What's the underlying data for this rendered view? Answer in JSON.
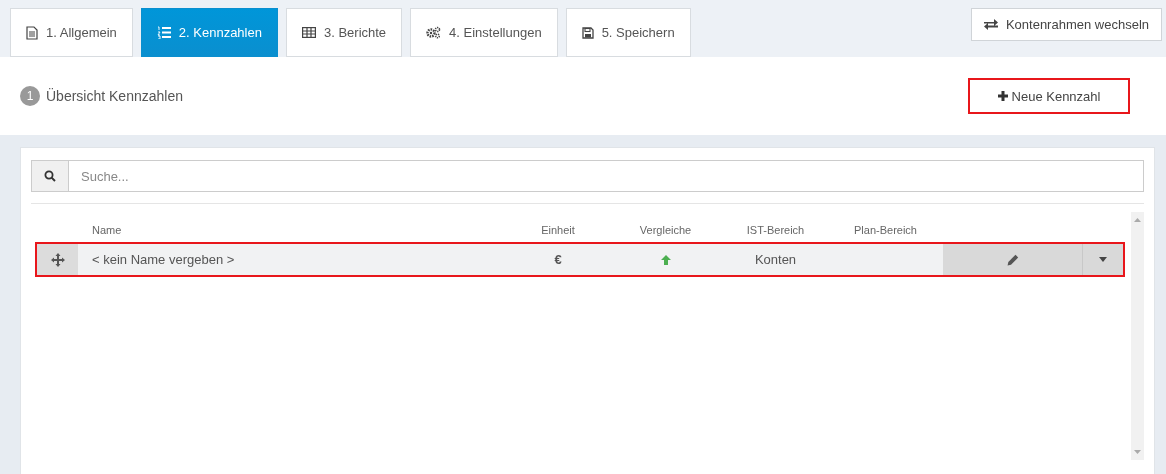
{
  "tabs": [
    {
      "label": "1. Allgemein",
      "selected": false
    },
    {
      "label": "2. Kennzahlen",
      "selected": true
    },
    {
      "label": "3. Berichte",
      "selected": false
    },
    {
      "label": "4. Einstellungen",
      "selected": false
    },
    {
      "label": "5. Speichern",
      "selected": false
    }
  ],
  "switch_button": {
    "label": "Kontenrahmen wechseln"
  },
  "section": {
    "step": "1",
    "title": "Übersicht Kennzahlen"
  },
  "new_button": {
    "label": "Neue Kennzahl",
    "highlighted": true
  },
  "search": {
    "placeholder": "Suche..."
  },
  "table": {
    "columns": [
      "Name",
      "Einheit",
      "Vergleiche",
      "IST-Bereich",
      "Plan-Bereich"
    ],
    "rows": [
      {
        "name": "< kein Name vergeben >",
        "unit": "€",
        "ist_range": "Konten",
        "highlighted": true
      }
    ]
  }
}
